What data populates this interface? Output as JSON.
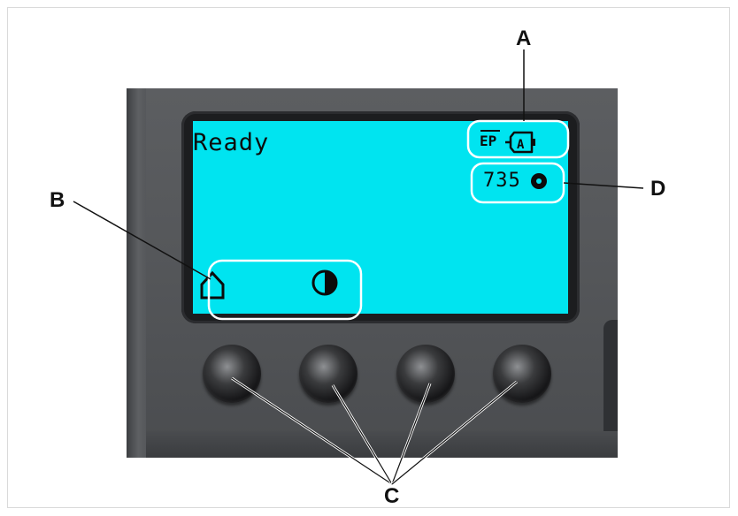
{
  "display": {
    "status_text": "Ready",
    "mode_indicator": "EP",
    "battery_letter": "A",
    "counter_value": "735",
    "counter_icon": "filled-circle-icon",
    "softkey_icons": [
      "home-icon",
      "contrast-icon"
    ],
    "background_color": "#00e4f0"
  },
  "callouts": {
    "A": "A",
    "B": "B",
    "C": "C",
    "D": "D"
  },
  "buttons": {
    "count": 4
  }
}
